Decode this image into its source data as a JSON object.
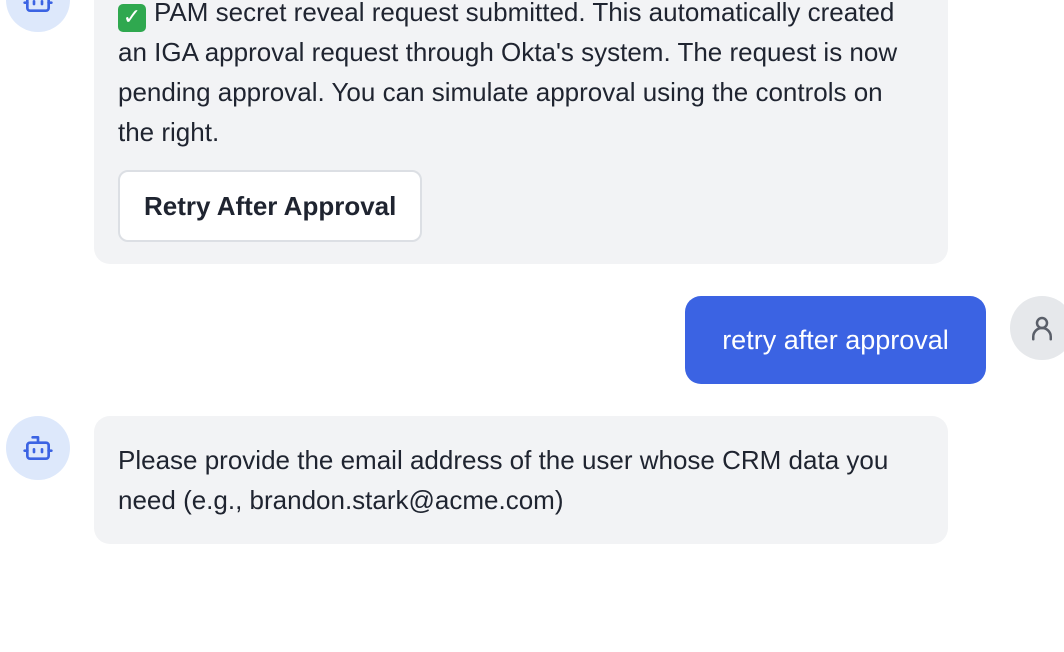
{
  "messages": [
    {
      "role": "assistant",
      "emoji": "✅",
      "text": "PAM secret reveal request submitted. This automatically created an IGA approval request through Okta's system. The request is now pending approval. You can simulate approval using the controls on the right.",
      "action_label": "Retry After Approval"
    },
    {
      "role": "user",
      "text": "retry after approval"
    },
    {
      "role": "assistant",
      "text": "Please provide the email address of the user whose CRM data you need (e.g., brandon.stark@acme.com)"
    }
  ],
  "colors": {
    "user_bubble": "#3b63e3",
    "bot_bubble": "#f2f3f5",
    "bot_avatar_bg": "#dde8fb",
    "bot_icon": "#3b63e3",
    "user_avatar_bg": "#e6e8eb",
    "user_icon": "#5a5f69"
  },
  "icons": {
    "bot": "bot-icon",
    "user": "user-icon"
  }
}
